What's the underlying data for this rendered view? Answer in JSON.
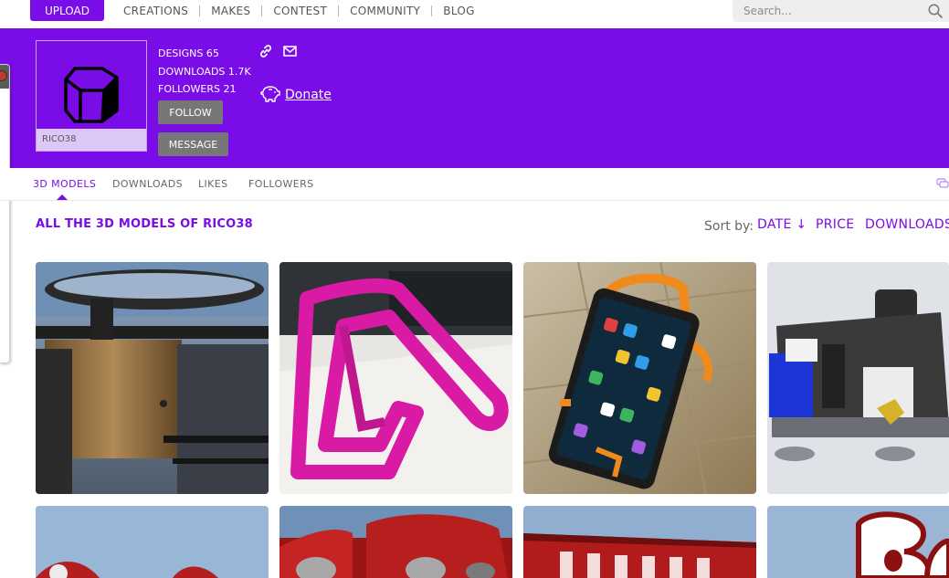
{
  "nav": {
    "upload_label": "UPLOAD",
    "links": [
      "CREATIONS",
      "MAKES",
      "CONTEST",
      "COMMUNITY",
      "BLOG"
    ],
    "search_placeholder": "Search..."
  },
  "profile": {
    "username": "RICO38",
    "stats": {
      "designs": "DESIGNS 65",
      "downloads": "DOWNLOADS 1.7K",
      "followers": "FOLLOWERS 21"
    },
    "follow_label": "FOLLOW",
    "message_label": "MESSAGE",
    "donate_label": "Donate"
  },
  "tabs": [
    "3D MODELS",
    "DOWNLOADS",
    "LIKES",
    "FOLLOWERS"
  ],
  "active_tab": "3D MODELS",
  "section": {
    "title": "ALL THE 3D MODELS OF RICO38",
    "sort_label": "Sort by:",
    "sort_options": [
      "DATE ↓",
      "PRICE",
      "DOWNLOADS"
    ]
  },
  "colors": {
    "brand": "#7a0ce8",
    "button_grey": "#777777"
  },
  "icons": [
    "search-icon",
    "link-icon",
    "mail-icon",
    "piggy-bank-icon",
    "chat-icon"
  ]
}
